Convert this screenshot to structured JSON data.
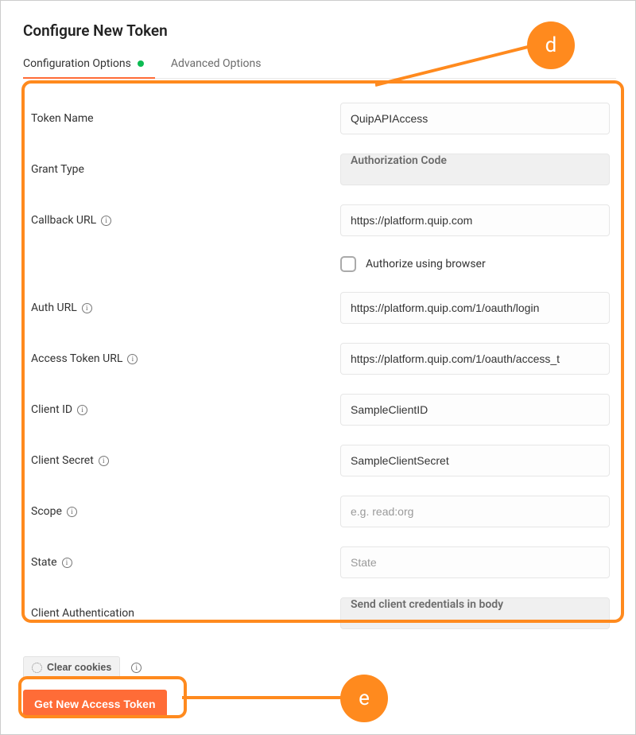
{
  "title": "Configure New Token",
  "tabs": {
    "configuration": "Configuration Options",
    "advanced": "Advanced Options"
  },
  "fields": {
    "token_name": {
      "label": "Token Name",
      "value": "QuipAPIAccess"
    },
    "grant_type": {
      "label": "Grant Type",
      "value": "Authorization Code"
    },
    "callback_url": {
      "label": "Callback URL",
      "value": "https://platform.quip.com"
    },
    "authorize_browser": {
      "label": "Authorize using browser"
    },
    "auth_url": {
      "label": "Auth URL",
      "value": "https://platform.quip.com/1/oauth/login"
    },
    "access_token_url": {
      "label": "Access Token URL",
      "value": "https://platform.quip.com/1/oauth/access_t"
    },
    "client_id": {
      "label": "Client ID",
      "value": "SampleClientID"
    },
    "client_secret": {
      "label": "Client Secret",
      "value": "SampleClientSecret"
    },
    "scope": {
      "label": "Scope",
      "placeholder": "e.g. read:org"
    },
    "state": {
      "label": "State",
      "placeholder": "State"
    },
    "client_auth": {
      "label": "Client Authentication",
      "value": "Send client credentials in body"
    }
  },
  "buttons": {
    "clear_cookies": "Clear cookies",
    "get_token": "Get New Access Token"
  },
  "callouts": {
    "d": "d",
    "e": "e"
  }
}
